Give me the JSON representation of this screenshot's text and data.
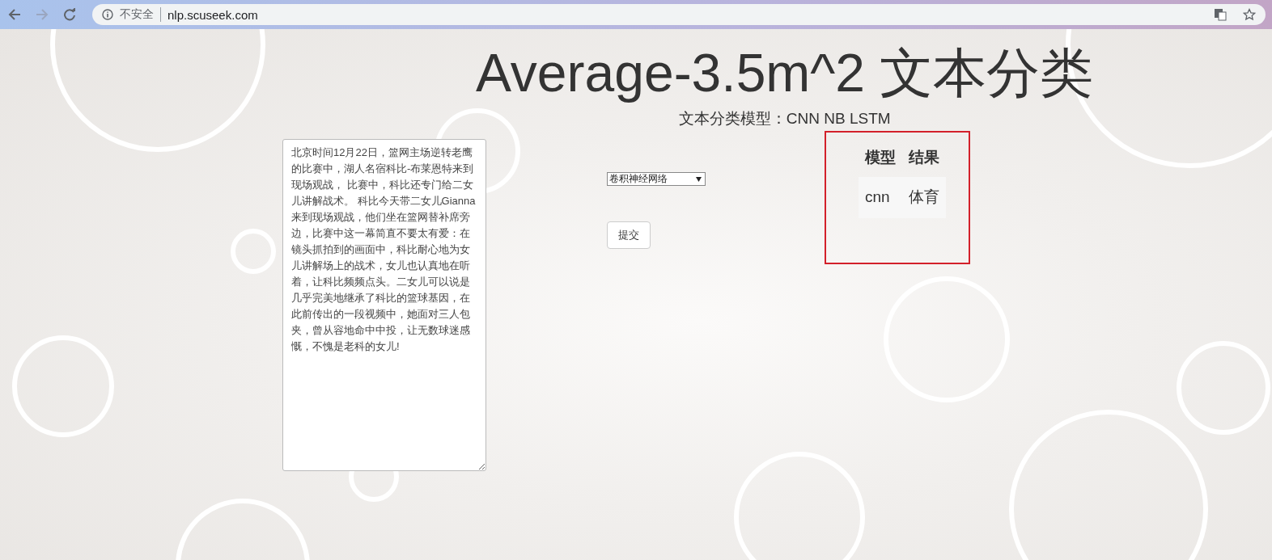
{
  "browser": {
    "security": "不安全",
    "url": "nlp.scuseek.com"
  },
  "title": "Average-3.5m^2 文本分类",
  "subtitle": "文本分类模型：CNN NB LSTM",
  "input": {
    "value": "北京时间12月22日，篮网主场逆转老鹰的比赛中，湖人名宿科比-布莱恩特来到现场观战， 比赛中，科比还专门给二女儿讲解战术。 科比今天带二女儿Gianna来到现场观战，他们坐在篮网替补席旁边，比赛中这一幕简直不要太有爱：在镜头抓拍到的画面中，科比耐心地为女儿讲解场上的战术，女儿也认真地在听着，让科比频频点头。二女儿可以说是几乎完美地继承了科比的篮球基因，在此前传出的一段视频中，她面对三人包夹，曾从容地命中中投，让无数球迷感慨，不愧是老科的女儿!"
  },
  "model_select": {
    "value": "卷积神经网络"
  },
  "submit": "提交",
  "results": {
    "columns": [
      "模型",
      "结果"
    ],
    "rows": [
      [
        "cnn",
        "体育"
      ]
    ]
  }
}
